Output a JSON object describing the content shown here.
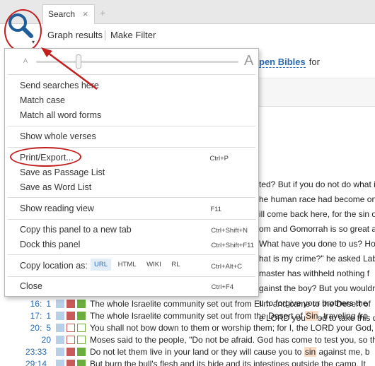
{
  "tabs": {
    "active_label": "Search",
    "close_glyph": "×",
    "new_tab_glyph": "+"
  },
  "toolbar": {
    "graph_results": "Graph results",
    "make_filter": "Make Filter",
    "search_icon": "magnifying-glass",
    "dropdown_glyph": "▾"
  },
  "search_header": {
    "bibles_label": "pen Bibles",
    "for_label": "for"
  },
  "menu": {
    "slider": {
      "small_label": "A",
      "large_label": "A"
    },
    "items": {
      "send_searches": "Send searches here",
      "match_case": "Match case",
      "match_all_word_forms": "Match all word forms",
      "show_whole_verses": "Show whole verses",
      "print_export": "Print/Export...",
      "print_export_shortcut": "Ctrl+P",
      "save_passage_list": "Save as Passage List",
      "save_word_list": "Save as Word List",
      "show_reading_view": "Show reading view",
      "show_reading_view_shortcut": "F11",
      "copy_panel": "Copy this panel to a new tab",
      "copy_panel_shortcut": "Ctrl+Shift+N",
      "dock_panel": "Dock this panel",
      "dock_panel_shortcut": "Ctrl+Shift+F11",
      "copy_location": "Copy location as:",
      "copy_location_shortcut": "Ctrl+Alt+C",
      "copy_formats": [
        "URL",
        "HTML",
        "WIKI",
        "RL"
      ],
      "close": "Close",
      "close_shortcut": "Ctrl+F4"
    }
  },
  "background_fragments": [
    "ted? But if you do not do what i",
    "he human race had become on",
    "ill come back here, for the sin o",
    "om and Gomorrah is so great a",
    "What have you done to us? Ho",
    "hat is my crime?\" he asked Lab",
    "master has withheld nothing f",
    "gainst the boy? But you wouldn",
    "u to forgive your brothers the",
    "e LORD your God to take this d"
  ],
  "results": [
    {
      "ref_a": "16:",
      "ref_b": "1",
      "text_before": "The whole Israelite community set out from Elim and came to the Desert of",
      "highlight": "",
      "text_after": ""
    },
    {
      "ref_a": "17:",
      "ref_b": "1",
      "text_before": "The whole Israelite community set out from the Desert of ",
      "highlight": "Sin",
      "text_after": ", traveling fro"
    },
    {
      "ref_a": "20:",
      "ref_b": "5",
      "text_before": "You shall not bow down to them or worship them; for I, the LORD your God, i",
      "highlight": "",
      "text_after": ""
    },
    {
      "ref_a": "",
      "ref_b": "20",
      "text_before": "Moses said to the people, \"Do not be afraid. God has come to test you, so th",
      "highlight": "",
      "text_after": ""
    },
    {
      "ref_a": "23:33",
      "ref_b": "",
      "text_before": "Do not let them live in your land or they will cause you to ",
      "highlight": "sin",
      "text_after": " against me, b"
    },
    {
      "ref_a": "29:14",
      "ref_b": "",
      "text_before": "But burn the bull's flesh and its hide and its intestines outside the camp. It",
      "highlight": "",
      "text_after": ""
    }
  ],
  "colors": {
    "accent_blue": "#2a6bb3",
    "annotation_red": "#c21f1f",
    "swatch_light_blue": "#b8cfe8",
    "swatch_red": "#c85a5a",
    "swatch_green": "#6cae3c",
    "highlight": "#f8dcc8"
  }
}
